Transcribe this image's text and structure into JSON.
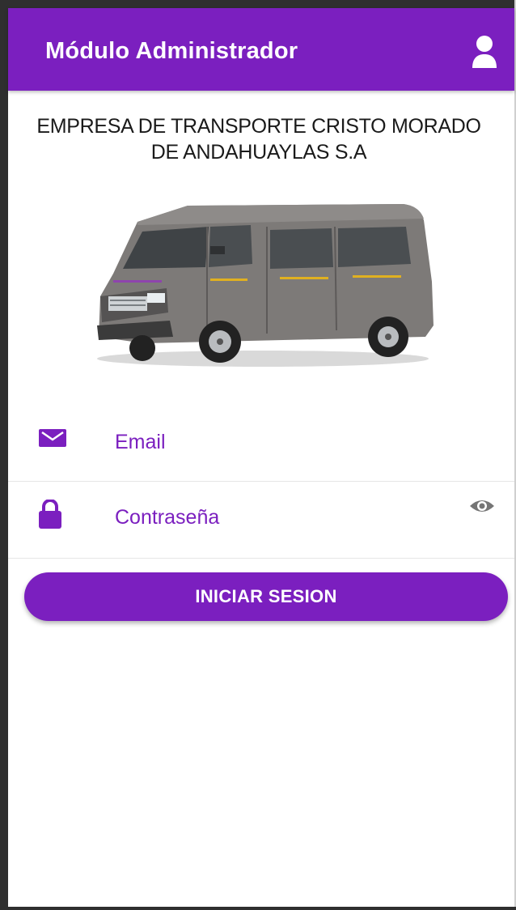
{
  "header": {
    "title": "Módulo Administrador",
    "user_icon": "user-icon"
  },
  "company": {
    "line1": "EMPRESA DE TRANSPORTE CRISTO MORADO",
    "line2": "DE ANDAHUAYLAS S.A"
  },
  "form": {
    "email": {
      "placeholder": "Email",
      "icon": "envelope-icon"
    },
    "password": {
      "placeholder": "Contraseña",
      "icon": "lock-icon",
      "toggle_icon": "eye-icon"
    },
    "submit_label": "INICIAR SESION"
  },
  "colors": {
    "primary": "#7b1fbf",
    "text": "#1a1a1a",
    "divider": "#e6e6e6",
    "eye": "#757575"
  }
}
